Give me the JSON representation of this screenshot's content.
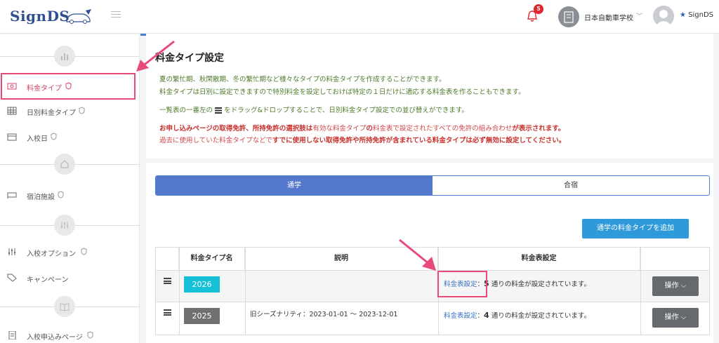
{
  "header": {
    "logo": "SignDS",
    "notification_count": "5",
    "school_name": "日本自動車学校",
    "user_name": "SignDS"
  },
  "sidebar": {
    "items": [
      {
        "label": "料金タイプ",
        "icon": "yen-bill-icon",
        "active": true
      },
      {
        "label": "日別料金タイプ",
        "icon": "calendar-grid-icon",
        "active": false
      },
      {
        "label": "入校日",
        "icon": "calendar-icon",
        "active": false
      },
      {
        "label": "宿泊施設",
        "icon": "bed-icon",
        "active": false
      },
      {
        "label": "入校オプション",
        "icon": "sliders-icon",
        "active": false
      },
      {
        "label": "キャンペーン",
        "icon": "tag-icon",
        "active": false
      },
      {
        "label": "入校申込みページ",
        "icon": "document-icon",
        "active": false
      }
    ],
    "section_icons": [
      "chart-icon",
      "home-icon",
      "sliders-icon",
      "book-icon"
    ]
  },
  "main": {
    "title": "料金タイプ設定",
    "desc_lines": [
      "夏の繁忙期、秋閑散期、冬の繁忙期など様々なタイプの料金タイプを作成することができます。",
      "料金タイプは日別に設定できますので特別料金を設定しておけば特定の１日だけに適応する料金表を作ることもできます。",
      "一覧表の一番左の",
      "をドラッグ&ドロップすることで、日別料金タイプ設定での並び替えができます。"
    ],
    "warn_line1_a": "お申し込みページの取得免許、所持免許の選択肢は",
    "warn_line1_b": "有効な料金タイプ",
    "warn_line1_c": "の",
    "warn_line1_d": "料金表で設定されたすべての免許の組み合わせ",
    "warn_line1_e": "が表示されます。",
    "warn_line2_a": "過去に使用していた料金タイプなどで",
    "warn_line2_b": "すでに使用しない取得免許や所持免許が含まれている料金タイプは必ず無効に設定してください。",
    "tabs": [
      {
        "label": "通学",
        "active": true
      },
      {
        "label": "合宿",
        "active": false
      }
    ],
    "add_button": "通学の料金タイプを追加",
    "table": {
      "headers": [
        "",
        "料金タイプ名",
        "説明",
        "料金表設定",
        ""
      ],
      "rows": [
        {
          "name": "2026",
          "color": "#16c0d6",
          "desc": "",
          "fee_link": "料金表設定",
          "fee_sep": "：",
          "fee_count": "5",
          "fee_suffix": " 通りの料金が設定されています。",
          "op": "操作"
        },
        {
          "name": "2025",
          "color": "#707070",
          "desc": "旧シーズナリティ：2023-01-01 〜 2023-12-01",
          "fee_link": "料金表設定",
          "fee_sep": "：",
          "fee_count": "4",
          "fee_suffix": " 通りの料金が設定されています。",
          "op": "操作"
        }
      ]
    }
  },
  "colors": {
    "accent": "#5479cc",
    "highlight": "#e94b79",
    "add_button": "#2e9ad9"
  }
}
